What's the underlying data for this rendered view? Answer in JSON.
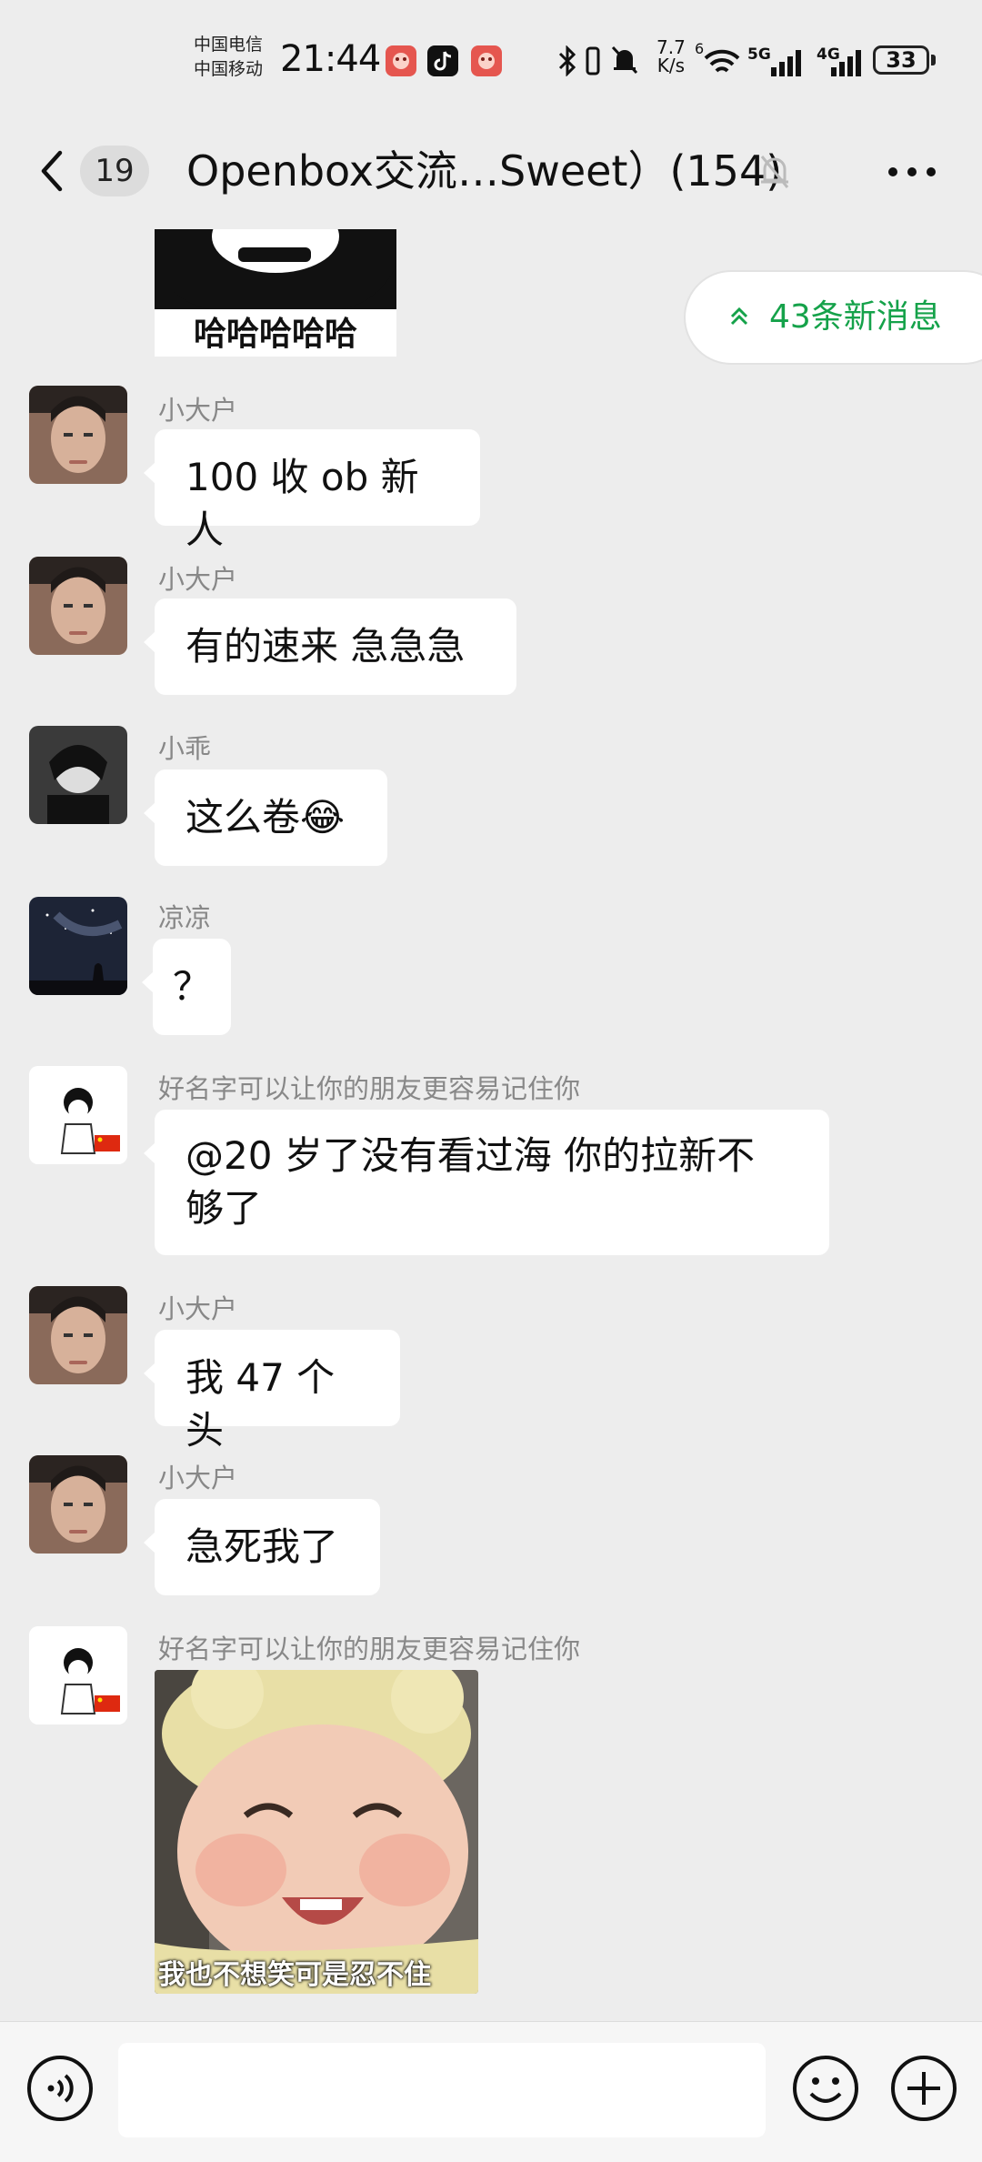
{
  "status_bar": {
    "carrier_1": "中国电信",
    "carrier_2": "中国移动",
    "time": "21:44",
    "net_speed_value": "7.7",
    "net_speed_unit": "K/s",
    "sig_5g": "5G",
    "sig_4g": "4G",
    "sig_6": "6",
    "battery": "33",
    "icons": [
      "app-icon-red",
      "tiktok-icon",
      "app-icon-red",
      "bluetooth-icon",
      "vibrate-icon",
      "mute-bell-icon",
      "wifi-icon",
      "signal-icon",
      "signal-icon",
      "battery-icon"
    ]
  },
  "header": {
    "unread_count": "19",
    "title": "Openbox交流…Sweet）(154)",
    "icons": [
      "back-chevron-icon",
      "muted-bell-icon",
      "more-dots-icon"
    ]
  },
  "new_messages_pill": {
    "label": "43条新消息",
    "icon": "double-chevron-up-icon",
    "color": "#15a24a"
  },
  "top_sticker": {
    "caption": "哈哈哈哈哈"
  },
  "messages": [
    {
      "sender": "小大户",
      "text": "100 收 ob 新人"
    },
    {
      "sender": "小大户",
      "text": "有的速来 急急急"
    },
    {
      "sender": "小乖",
      "text": "这么卷😂"
    },
    {
      "sender": "凉凉",
      "text": "？"
    },
    {
      "sender": "好名字可以让你的朋友更容易记住你",
      "text_line1": "@20 岁了没有看过海  你的拉新不",
      "text_line2": "够了"
    },
    {
      "sender": "小大户",
      "text": "我 47 个头"
    },
    {
      "sender": "小大户",
      "text": "急死我了"
    },
    {
      "sender": "好名字可以让你的朋友更容易记住你",
      "image_caption": "我也不想笑可是忍不住"
    }
  ],
  "bottom_bar": {
    "icons": [
      "voice-icon",
      "emoji-icon",
      "plus-icon"
    ]
  },
  "colors": {
    "background": "#ededed",
    "bubble": "#ffffff",
    "accent_green": "#15a24a"
  }
}
